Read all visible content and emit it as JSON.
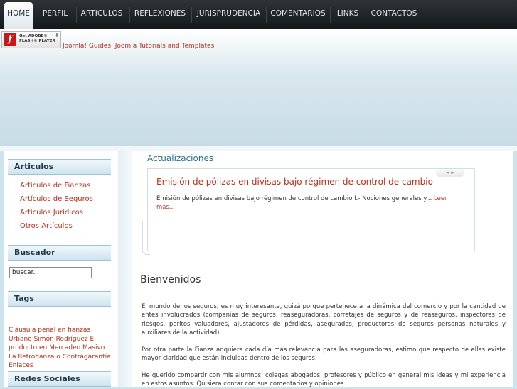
{
  "nav": {
    "items": [
      "HOME",
      "PERFIL",
      "ARTICULOS",
      "REFLEXIONES",
      "JURISPRUDENCIA",
      "COMENTARIOS",
      "LINKS",
      "CONTACTOS"
    ],
    "active_index": 0
  },
  "flash_badge": {
    "logo": "f",
    "line1": "Get ADOBE®",
    "line2": "FLASH® PLAYER"
  },
  "header": {
    "link_text": "Joomla! Guides, Joomla Tutorials and Templates"
  },
  "sidebar": {
    "articulos": {
      "title": "Articulos",
      "links": [
        "Artículos de Fianzas",
        "Artículos de Seguros",
        "Artículos Jurídicos",
        "Otros Artículos"
      ]
    },
    "buscador": {
      "title": "Buscador",
      "input_value": "buscar..."
    },
    "tags": {
      "title": "Tags",
      "text": "Cláusula penal en fianzas Urbano Simón Rodríguez El producto en Mercadeo Masivo La Retrofianza o Contragarantía Enlaces"
    },
    "redes": {
      "title": "Redes Sociales"
    }
  },
  "main": {
    "actualizaciones_title": "Actualizaciones",
    "news": {
      "arrows": "◄ ►",
      "title": "Emisión de pólizas en divisas bajo régimen de control de cambio",
      "text": "Emisión de pólizas en divisas bajo régimen de control de cambio     I.- Nociones generales y...",
      "read_more": "Leer más..."
    },
    "bienvenidos": "Bienvenidos",
    "paragraphs": [
      "El mundo de los seguros, es muy interesante, quizá porque pertenece a la dinámica del comercio y por la cantidad de entes involucrados (compañías de seguros, reaseguradoras, corretajes de seguros y de reaseguros, inspectores de riesgos, peritos valuadores, ajustadores de pérdidas, asegurados, productores de seguros personas naturales y auxiliares de la actividad).",
      "Por otra parte la Fianza adquiere cada día más relevancia para las aseguradoras, estimo que respecto de ellas existe mayor claridad que están incluidas dentro de los seguros.",
      "He querido compartir con mis alumnos, colegas abogados, profesores y público en general  mis ideas y mi experiencia en estos asuntos. Quisiera contar con sus comentarios y opiniones."
    ]
  }
}
